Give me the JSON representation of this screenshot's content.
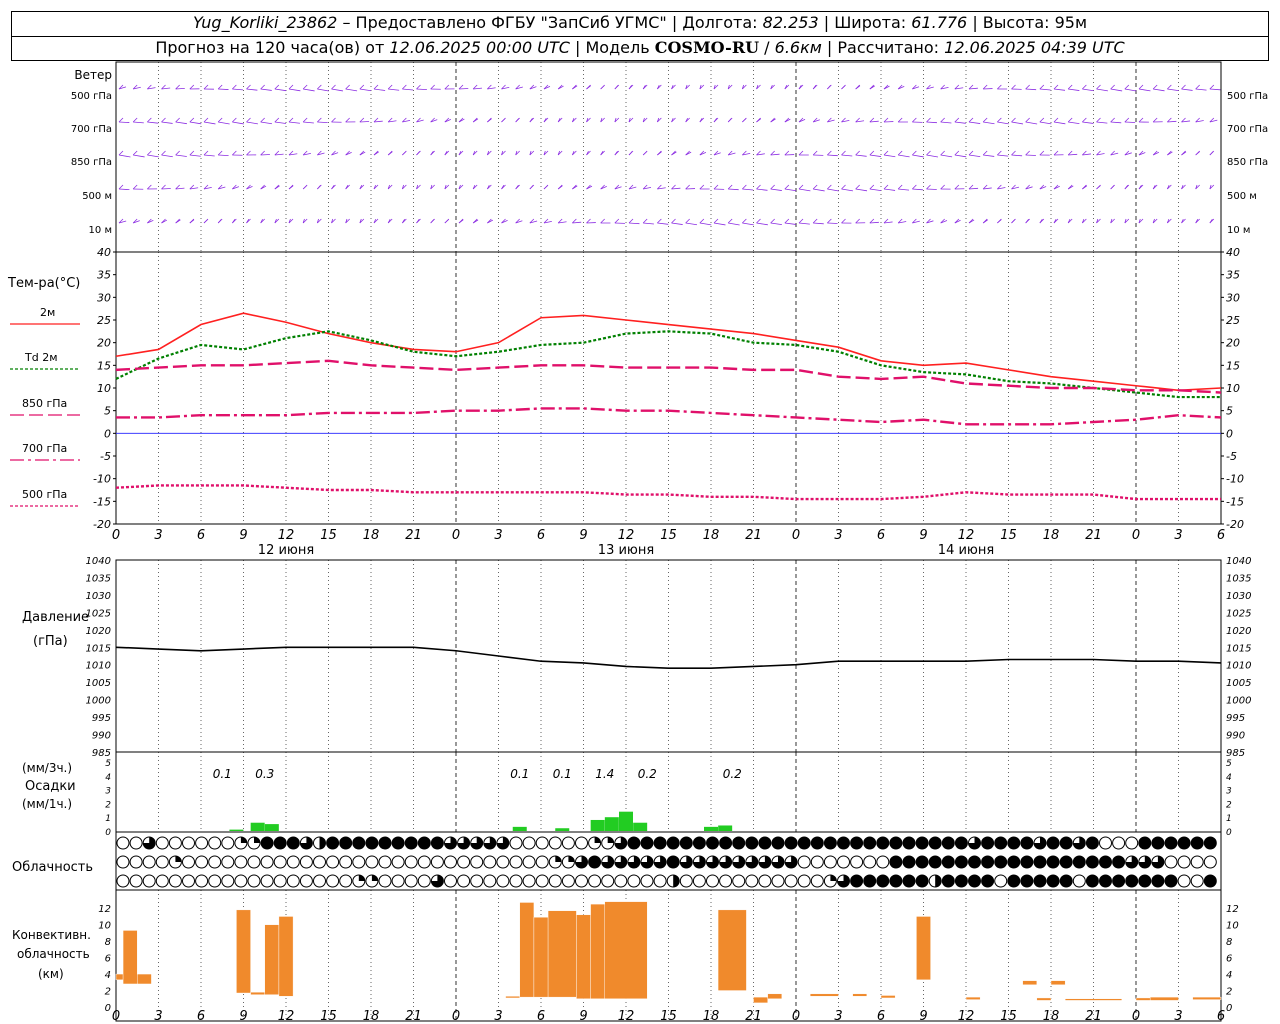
{
  "header": {
    "station": "Yug_Korliki_23862",
    "provided": " – Предоставлено ФГБУ \"ЗапСиб УГМС\" | Долгота: ",
    "lon": "82.253",
    "lat_label": " | Широта: ",
    "lat": "61.776",
    "alt_label": " | Высота: ",
    "alt": "95м",
    "forecast_label": "Прогноз на 120 часа(ов) от ",
    "start": "12.06.2025 00:00 UTC",
    "model_label": " | Модель ",
    "model": "COSMO-RU",
    "model_sep": " / ",
    "grid": "6.6км",
    "calc_label": " | Рассчитано: ",
    "calc": "12.06.2025 04:39 UTC"
  },
  "panels": {
    "wind": {
      "title": "Ветер",
      "levels": [
        "500 гПа",
        "700 гПа",
        "850 гПа",
        "500 м",
        "10  м"
      ]
    },
    "temp": {
      "title": "Тем-ра(°C)",
      "legend": [
        {
          "label": "2м",
          "color": "#ff2020"
        },
        {
          "label": "Td 2м",
          "color": "#008000"
        },
        {
          "label": "850 гПа",
          "color": "#e0106a"
        },
        {
          "label": "700 гПа",
          "color": "#e0106a"
        },
        {
          "label": "500 гПа",
          "color": "#e0106a"
        }
      ]
    },
    "pres": {
      "title": "Давление",
      "unit": "(гПа)"
    },
    "prec": {
      "unit1": "(мм/3ч.)",
      "title": "Осадки",
      "unit2": "(мм/1ч.)"
    },
    "cloud": {
      "title": "Облачность"
    },
    "conv": {
      "title1": "Конвективн.",
      "title2": "облачность",
      "unit": "(км)"
    }
  },
  "x_axis": {
    "hour_labels": [
      "0",
      "3",
      "6",
      "9",
      "12",
      "15",
      "18",
      "21",
      "0",
      "3",
      "6",
      "9",
      "12",
      "15",
      "18",
      "21",
      "0",
      "3",
      "6",
      "9",
      "12",
      "15",
      "18",
      "21",
      "0",
      "3",
      "6"
    ],
    "days": [
      "12 июня",
      "13 июня",
      "14 июня"
    ]
  },
  "chart_data": [
    {
      "type": "line",
      "name": "temperature",
      "x_hours": [
        0,
        3,
        6,
        9,
        12,
        15,
        18,
        21,
        24,
        27,
        30,
        33,
        36,
        39,
        42,
        45,
        48,
        51,
        54,
        57,
        60,
        63,
        66,
        69,
        72,
        75,
        78
      ],
      "series": [
        {
          "name": "2м",
          "color": "#ff2020",
          "values": [
            17,
            18.5,
            24,
            26.5,
            24.5,
            22,
            20,
            18.5,
            18,
            20,
            25.5,
            26,
            25,
            24,
            23,
            22,
            20.5,
            19,
            16,
            15,
            15.5,
            14,
            12.5,
            11.5,
            10.5,
            9.5,
            10
          ]
        },
        {
          "name": "Td 2м",
          "color": "#008000",
          "values": [
            12,
            16.5,
            19.5,
            18.5,
            21,
            22.5,
            20.5,
            18,
            17,
            18,
            19.5,
            20,
            22,
            22.5,
            22,
            20,
            19.5,
            18,
            15,
            13.5,
            13,
            11.5,
            11,
            10,
            9,
            8,
            8
          ]
        },
        {
          "name": "850 гПа",
          "color": "#e0106a",
          "values": [
            14,
            14.5,
            15,
            15,
            15.5,
            16,
            15,
            14.5,
            14,
            14.5,
            15,
            15,
            14.5,
            14.5,
            14.5,
            14,
            14,
            12.5,
            12,
            12.5,
            11,
            10.5,
            10,
            10,
            9.5,
            9.5,
            9
          ]
        },
        {
          "name": "700 гПа",
          "color": "#e0106a",
          "values": [
            3.5,
            3.5,
            4,
            4,
            4,
            4.5,
            4.5,
            4.5,
            5,
            5,
            5.5,
            5.5,
            5,
            5,
            4.5,
            4,
            3.5,
            3,
            2.5,
            3,
            2,
            2,
            2,
            2.5,
            3,
            4,
            3.5
          ]
        },
        {
          "name": "500 гПа",
          "color": "#e0106a",
          "values": [
            -12,
            -11.5,
            -11.5,
            -11.5,
            -12,
            -12.5,
            -12.5,
            -13,
            -13,
            -13,
            -13,
            -13,
            -13.5,
            -13.5,
            -14,
            -14,
            -14.5,
            -14.5,
            -14.5,
            -14,
            -13,
            -13.5,
            -13.5,
            -13.5,
            -14.5,
            -14.5,
            -14.5
          ]
        }
      ],
      "ylim": [
        -20,
        40
      ]
    },
    {
      "type": "line",
      "name": "pressure",
      "x_hours": [
        0,
        3,
        6,
        9,
        12,
        15,
        18,
        21,
        24,
        27,
        30,
        33,
        36,
        39,
        42,
        45,
        48,
        51,
        54,
        57,
        60,
        63,
        66,
        69,
        72,
        75,
        78
      ],
      "series": [
        {
          "color": "#000000",
          "values": [
            1015,
            1014.5,
            1014,
            1014.5,
            1015,
            1015,
            1015,
            1015,
            1014,
            1012.5,
            1011,
            1010.5,
            1009.5,
            1009,
            1009,
            1009.5,
            1010,
            1011,
            1011,
            1011,
            1011,
            1011.5,
            1011.5,
            1011.5,
            1011,
            1011,
            1010.5
          ]
        }
      ],
      "ylim": [
        985,
        1040
      ]
    },
    {
      "type": "bar",
      "name": "precipitation",
      "bars_mm_per_hour": [
        {
          "h": 8.5,
          "v": 0.05
        },
        {
          "h": 10,
          "v": 0.3
        },
        {
          "h": 11,
          "v": 0.25
        },
        {
          "h": 28.5,
          "v": 0.15
        },
        {
          "h": 31.5,
          "v": 0.1
        },
        {
          "h": 34,
          "v": 0.4
        },
        {
          "h": 35,
          "v": 0.5
        },
        {
          "h": 36,
          "v": 0.7
        },
        {
          "h": 37,
          "v": 0.3
        },
        {
          "h": 42,
          "v": 0.15
        },
        {
          "h": 43,
          "v": 0.2
        }
      ],
      "labels_mm_per_3h": [
        {
          "h": 7.5,
          "t": "0.1"
        },
        {
          "h": 10.5,
          "t": "0.3"
        },
        {
          "h": 28.5,
          "t": "0.1"
        },
        {
          "h": 31.5,
          "t": "0.1"
        },
        {
          "h": 34.5,
          "t": "1.4"
        },
        {
          "h": 37.5,
          "t": "0.2"
        },
        {
          "h": 43.5,
          "t": "0.2"
        }
      ],
      "ylim": [
        0,
        5
      ]
    },
    {
      "type": "table",
      "name": "cloudiness",
      "note": "0 = clear … 4 = overcast, per hour",
      "rows": [
        "0030000001144432444444444333330000001134444444444444444444444444434444344340004444444",
        "0000100000000000000000000000000001134333334333333333000000044444444444444444433300000",
        "0000000000000000001100003000000000000000002000000000001344444424444044444044444440044"
      ]
    },
    {
      "type": "bar",
      "name": "convective_cloud",
      "bars_km": [
        {
          "h0": 0,
          "h1": 0.5,
          "lo": 3.3,
          "hi": 4
        },
        {
          "h0": 0.5,
          "h1": 1.5,
          "lo": 2.8,
          "hi": 9.3
        },
        {
          "h0": 1.5,
          "h1": 2.5,
          "lo": 2.8,
          "hi": 4
        },
        {
          "h0": 8.5,
          "h1": 9.5,
          "lo": 1.7,
          "hi": 11.8
        },
        {
          "h0": 9.5,
          "h1": 10.5,
          "lo": 1.5,
          "hi": 1.8
        },
        {
          "h0": 10.5,
          "h1": 11.5,
          "lo": 1.5,
          "hi": 10
        },
        {
          "h0": 11.5,
          "h1": 12.5,
          "lo": 1.3,
          "hi": 11
        },
        {
          "h0": 27.5,
          "h1": 28.5,
          "lo": 1.1,
          "hi": 1.3
        },
        {
          "h0": 28.5,
          "h1": 29.5,
          "lo": 1.2,
          "hi": 12.7
        },
        {
          "h0": 29.5,
          "h1": 30.5,
          "lo": 1.2,
          "hi": 10.9
        },
        {
          "h0": 30.5,
          "h1": 32.5,
          "lo": 1.2,
          "hi": 11.7
        },
        {
          "h0": 32.5,
          "h1": 33.5,
          "lo": 1,
          "hi": 11.2
        },
        {
          "h0": 33.5,
          "h1": 34.5,
          "lo": 1,
          "hi": 12.5
        },
        {
          "h0": 34.5,
          "h1": 37.5,
          "lo": 1,
          "hi": 12.8
        },
        {
          "h0": 42.5,
          "h1": 44.5,
          "lo": 2,
          "hi": 11.8
        },
        {
          "h0": 45,
          "h1": 46,
          "lo": 0.5,
          "hi": 1.2
        },
        {
          "h0": 46,
          "h1": 47,
          "lo": 1,
          "hi": 1.6
        },
        {
          "h0": 49,
          "h1": 51,
          "lo": 1.3,
          "hi": 1.6
        },
        {
          "h0": 52,
          "h1": 53,
          "lo": 1.3,
          "hi": 1.6
        },
        {
          "h0": 54,
          "h1": 55,
          "lo": 1.1,
          "hi": 1.4
        },
        {
          "h0": 56.5,
          "h1": 57.5,
          "lo": 3.3,
          "hi": 11
        },
        {
          "h0": 60,
          "h1": 61,
          "lo": 0.9,
          "hi": 1.2
        },
        {
          "h0": 64,
          "h1": 65,
          "lo": 2.7,
          "hi": 3.2
        },
        {
          "h0": 65,
          "h1": 66,
          "lo": 0.8,
          "hi": 1.1
        },
        {
          "h0": 66,
          "h1": 67,
          "lo": 2.7,
          "hi": 3.2
        },
        {
          "h0": 67,
          "h1": 71,
          "lo": 0.8,
          "hi": 1
        },
        {
          "h0": 72,
          "h1": 73,
          "lo": 0.8,
          "hi": 1.1
        },
        {
          "h0": 73,
          "h1": 75,
          "lo": 0.8,
          "hi": 1.2
        },
        {
          "h0": 76,
          "h1": 78,
          "lo": 0.9,
          "hi": 1.2
        }
      ],
      "ylim": [
        0,
        13
      ]
    }
  ]
}
